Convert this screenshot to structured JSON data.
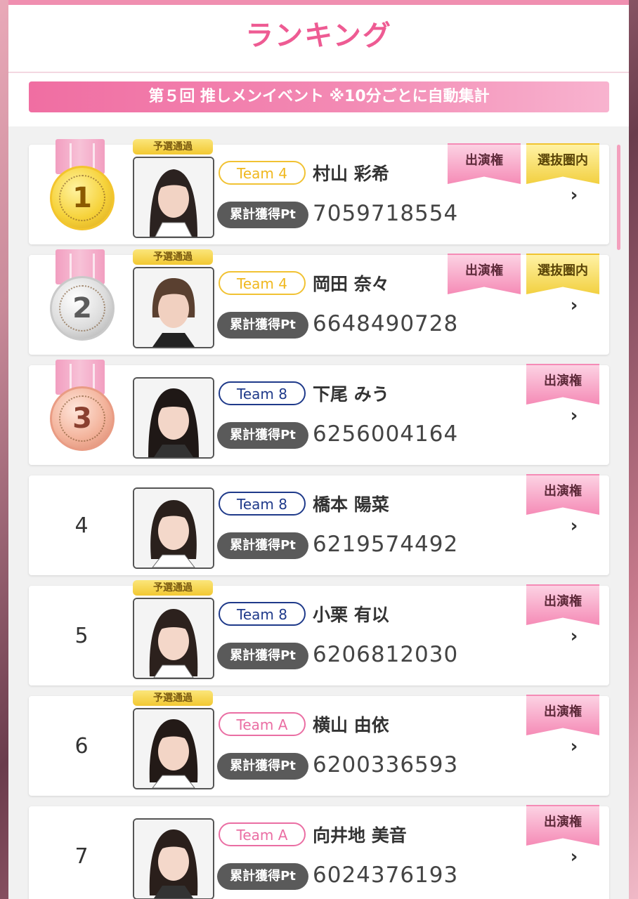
{
  "header": {
    "title": "ランキング"
  },
  "banner": {
    "text": "第５回 推しメンイベント ※10分ごとに自動集計"
  },
  "labels": {
    "points_label": "累計獲得Pt",
    "prelim_tag": "予選通過",
    "appearance_ribbon": "出演権",
    "selection_ribbon": "選抜圏内"
  },
  "rankings": [
    {
      "rank": "1",
      "team": "Team 4",
      "name": "村山 彩希",
      "points": "7059718554",
      "prelim": true,
      "selection": true
    },
    {
      "rank": "2",
      "team": "Team 4",
      "name": "岡田 奈々",
      "points": "6648490728",
      "prelim": true,
      "selection": true
    },
    {
      "rank": "3",
      "team": "Team 8",
      "name": "下尾 みう",
      "points": "6256004164",
      "prelim": false,
      "selection": false
    },
    {
      "rank": "4",
      "team": "Team 8",
      "name": "橋本 陽菜",
      "points": "6219574492",
      "prelim": false,
      "selection": false
    },
    {
      "rank": "5",
      "team": "Team 8",
      "name": "小栗 有以",
      "points": "6206812030",
      "prelim": true,
      "selection": false
    },
    {
      "rank": "6",
      "team": "Team A",
      "name": "横山 由依",
      "points": "6200336593",
      "prelim": true,
      "selection": false
    },
    {
      "rank": "7",
      "team": "Team A",
      "name": "向井地 美音",
      "points": "6024376193",
      "prelim": false,
      "selection": false
    }
  ],
  "colors": {
    "accent": "#ee5b93",
    "team4": "#f0b81e",
    "team8": "#1f3a8a",
    "teamA": "#ea6ea3"
  }
}
